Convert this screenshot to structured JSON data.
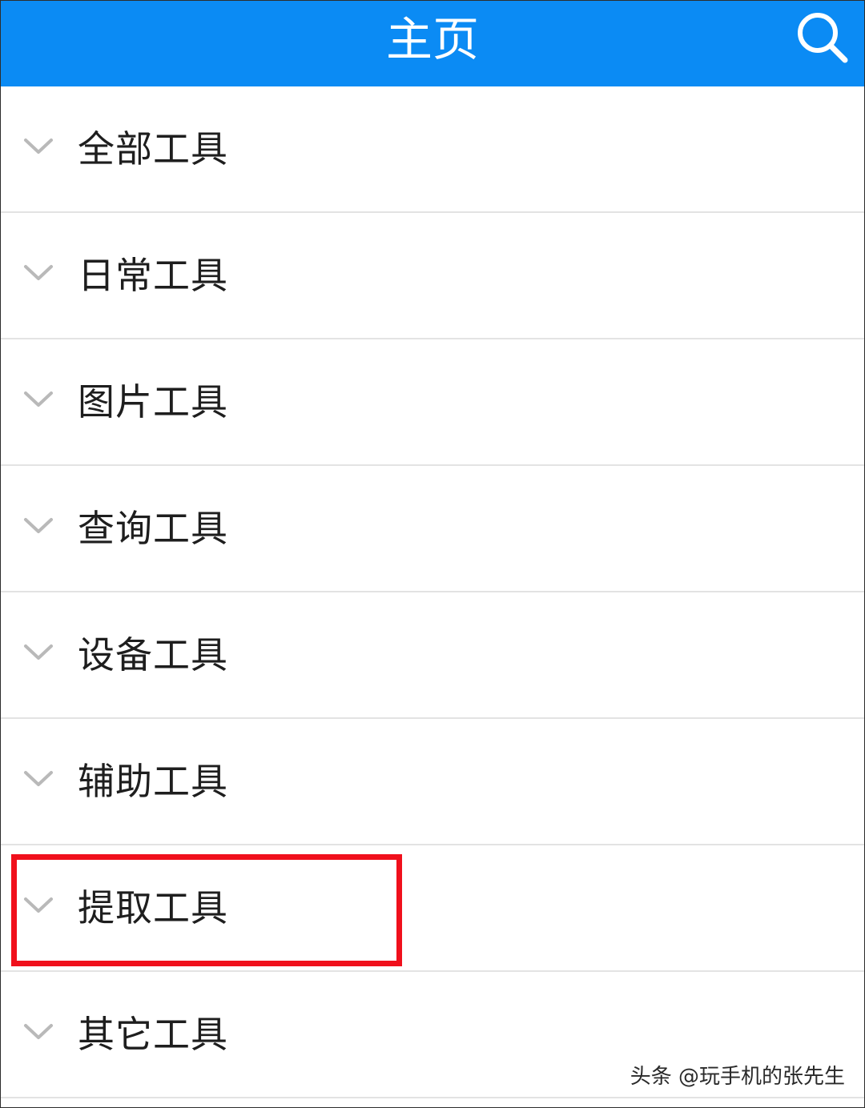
{
  "header": {
    "title": "主页",
    "search_icon": "search-icon",
    "bg_color": "#0b8bf4"
  },
  "tool_list": {
    "items": [
      {
        "label": "全部工具",
        "icon": "chevron-down-icon"
      },
      {
        "label": "日常工具",
        "icon": "chevron-down-icon"
      },
      {
        "label": "图片工具",
        "icon": "chevron-down-icon"
      },
      {
        "label": "查询工具",
        "icon": "chevron-down-icon"
      },
      {
        "label": "设备工具",
        "icon": "chevron-down-icon"
      },
      {
        "label": "辅助工具",
        "icon": "chevron-down-icon"
      },
      {
        "label": "提取工具",
        "icon": "chevron-down-icon",
        "highlighted": true
      },
      {
        "label": "其它工具",
        "icon": "chevron-down-icon"
      }
    ]
  },
  "highlight": {
    "color": "#f0101c",
    "target": "提取工具"
  },
  "watermark": {
    "text": "头条 @玩手机的张先生"
  }
}
